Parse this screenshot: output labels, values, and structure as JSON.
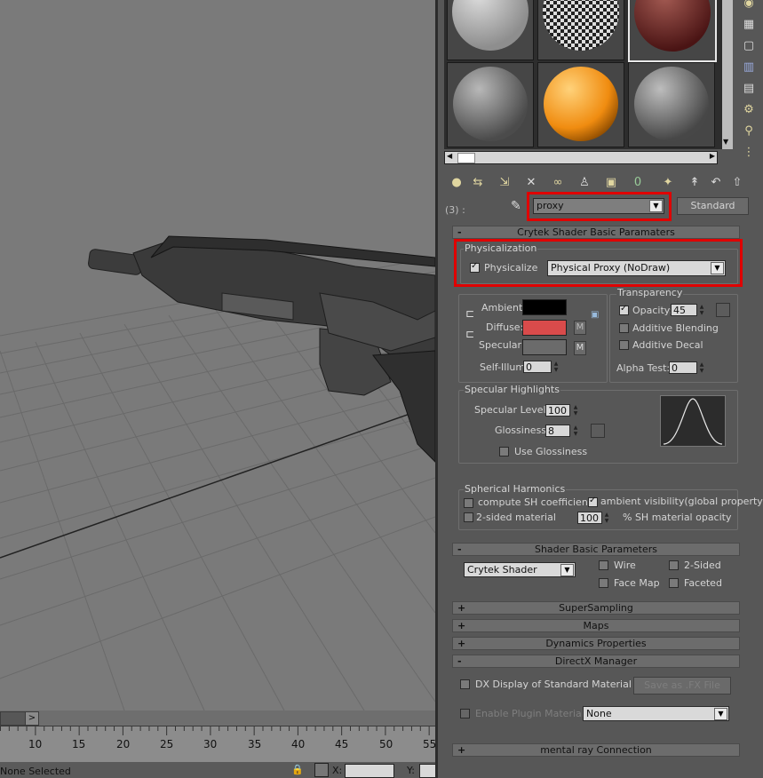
{
  "timeline": {
    "ticks": [
      "10",
      "15",
      "20",
      "25",
      "30",
      "35",
      "40",
      "45",
      "50",
      "55"
    ],
    "scroll_arrow": ">"
  },
  "status": {
    "selection": "None Selected",
    "x_label": "X:",
    "y_label": "Y:"
  },
  "material": {
    "slot_index": "(3) :",
    "name": "proxy",
    "type_button": "Standard"
  },
  "crytek_shader": {
    "title": "Crytek Shader Basic Paramaters",
    "physicalization_group": "Physicalization",
    "physicalize_label": "Physicalize",
    "physicalize_checked": true,
    "physicalize_type": "Physical Proxy (NoDraw)",
    "ambient_label": "Ambient:",
    "diffuse_label": "Diffuse:",
    "specular_label": "Specular:",
    "self_illum_label": "Self-Illum:",
    "self_illum_value": "0",
    "m_label": "M",
    "ambient_color": "#000000",
    "diffuse_color": "#d94b4b",
    "specular_color": "#6b6b6b",
    "transparency_group": "Transparency",
    "opacity_label": "Opacity:",
    "opacity_value": "45",
    "opacity_checked": true,
    "additive_blending_label": "Additive Blending",
    "additive_decal_label": "Additive Decal",
    "alpha_test_label": "Alpha Test:",
    "alpha_test_value": "0",
    "specular_group": "Specular Highlights",
    "specular_level_label": "Specular Level:",
    "specular_level_value": "100",
    "glossiness_label": "Glossiness:",
    "glossiness_value": "8",
    "use_glossiness_label": "Use Glossiness",
    "sh_group": "Spherical Harmonics",
    "compute_sh_label": "compute SH coefficients",
    "ambient_visibility_label": "ambient visibility(global property)",
    "ambient_visibility_checked": true,
    "two_sided_material_label": "2-sided material",
    "sh_opacity_value": "100",
    "sh_opacity_label": "% SH material opacity"
  },
  "shader_basic": {
    "title": "Shader Basic Parameters",
    "shader": "Crytek Shader",
    "wire_label": "Wire",
    "two_sided_label": "2-Sided",
    "face_map_label": "Face Map",
    "faceted_label": "Faceted"
  },
  "rollouts": {
    "supersampling": "SuperSampling",
    "maps": "Maps",
    "dynamics": "Dynamics Properties",
    "directx": "DirectX Manager",
    "mental_ray": "mental ray Connection",
    "plus": "+",
    "minus": "-"
  },
  "directx": {
    "dx_display_label": "DX Display of Standard Material",
    "save_fx_label": "Save as .FX File",
    "enable_plugin_label": "Enable Plugin Material",
    "plugin_value": "None"
  },
  "colors": {
    "highlight": "#e00000",
    "orange_sphere": "#f08c10",
    "panel_bg": "#575757",
    "viewport_bg": "#7a7a7a"
  }
}
